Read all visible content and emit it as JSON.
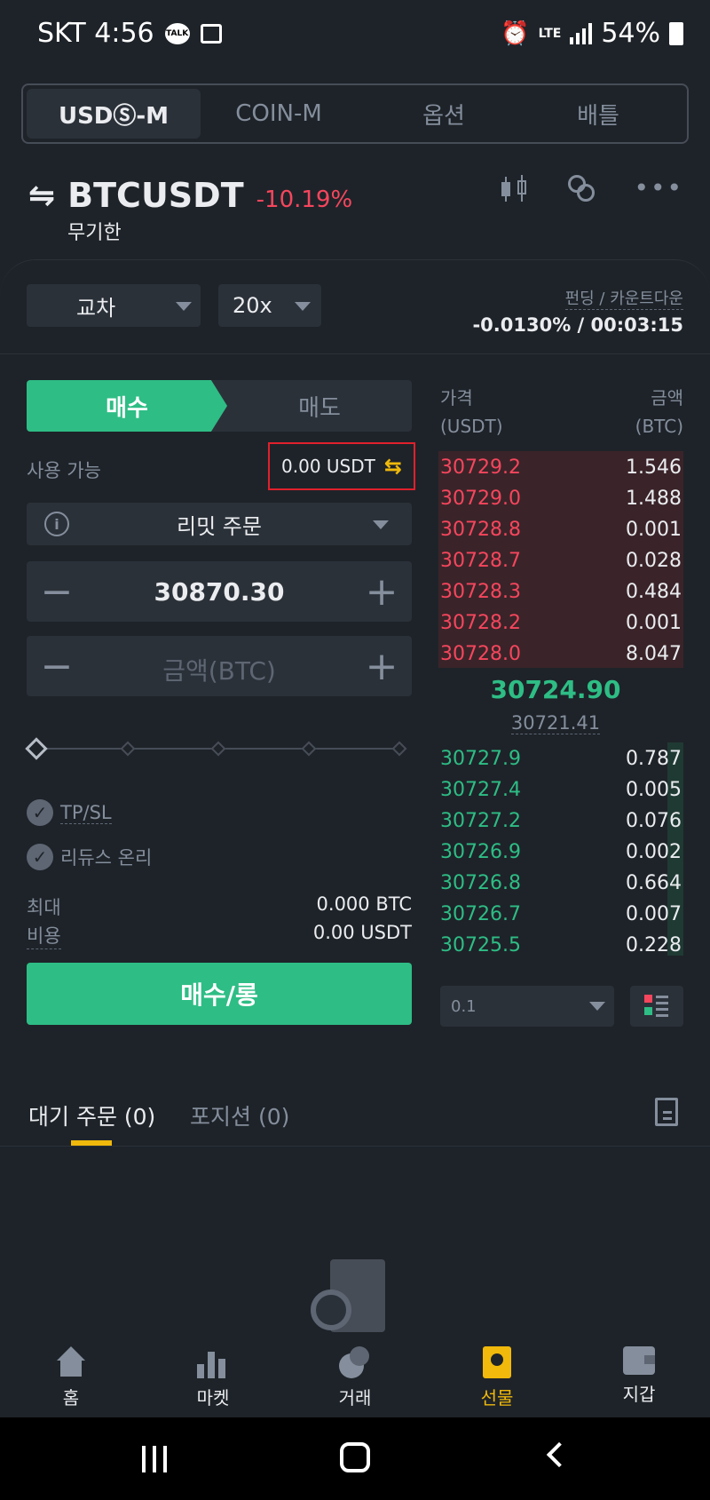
{
  "status_bar": {
    "carrier_time": "SKT 4:56",
    "network": "LTE",
    "battery": "54%"
  },
  "top_tabs": [
    {
      "label": "USDⓈ-M",
      "active": true
    },
    {
      "label": "COIN-M",
      "active": false
    },
    {
      "label": "옵션",
      "active": false
    },
    {
      "label": "배틀",
      "active": false
    }
  ],
  "header": {
    "symbol": "BTCUSDT",
    "change": "-10.19%",
    "subtitle": "무기한"
  },
  "controls": {
    "margin_mode": "교차",
    "leverage": "20x",
    "funding_label": "펀딩 / 카운트다운",
    "funding_value": "-0.0130% / 00:03:15"
  },
  "order_form": {
    "buy_tab": "매수",
    "sell_tab": "매도",
    "available_label": "사용 가능",
    "available_value": "0.00 USDT",
    "order_type": "리밋 주문",
    "price_value": "30870.30",
    "amount_placeholder": "금액(BTC)",
    "tpsl_label": "TP/SL",
    "reduce_only_label": "리듀스 온리",
    "max_label": "최대",
    "max_value": "0.000 BTC",
    "cost_label": "비용",
    "cost_value": "0.00 USDT",
    "submit_label": "매수/롱"
  },
  "order_book": {
    "price_header": "가격",
    "price_unit": "(USDT)",
    "amount_header": "금액",
    "amount_unit": "(BTC)",
    "asks": [
      {
        "price": "30729.2",
        "amount": "1.546"
      },
      {
        "price": "30729.0",
        "amount": "1.488"
      },
      {
        "price": "30728.8",
        "amount": "0.001"
      },
      {
        "price": "30728.7",
        "amount": "0.028"
      },
      {
        "price": "30728.3",
        "amount": "0.484"
      },
      {
        "price": "30728.2",
        "amount": "0.001"
      },
      {
        "price": "30728.0",
        "amount": "8.047"
      }
    ],
    "last_price": "30724.90",
    "mark_price": "30721.41",
    "bids": [
      {
        "price": "30727.9",
        "amount": "0.787"
      },
      {
        "price": "30727.4",
        "amount": "0.005"
      },
      {
        "price": "30727.2",
        "amount": "0.076"
      },
      {
        "price": "30726.9",
        "amount": "0.002"
      },
      {
        "price": "30726.8",
        "amount": "0.664"
      },
      {
        "price": "30726.7",
        "amount": "0.007"
      },
      {
        "price": "30725.5",
        "amount": "0.228"
      }
    ],
    "tick_size": "0.1"
  },
  "bottom_tabs": {
    "open_orders": "대기 주문 (0)",
    "positions": "포지션 (0)"
  },
  "nav": [
    {
      "label": "홈"
    },
    {
      "label": "마켓"
    },
    {
      "label": "거래"
    },
    {
      "label": "선물",
      "active": true
    },
    {
      "label": "지갑"
    }
  ],
  "colors": {
    "buy": "#2ebd85",
    "sell": "#f6465d",
    "accent": "#f0b90b",
    "bg": "#1e2329"
  }
}
